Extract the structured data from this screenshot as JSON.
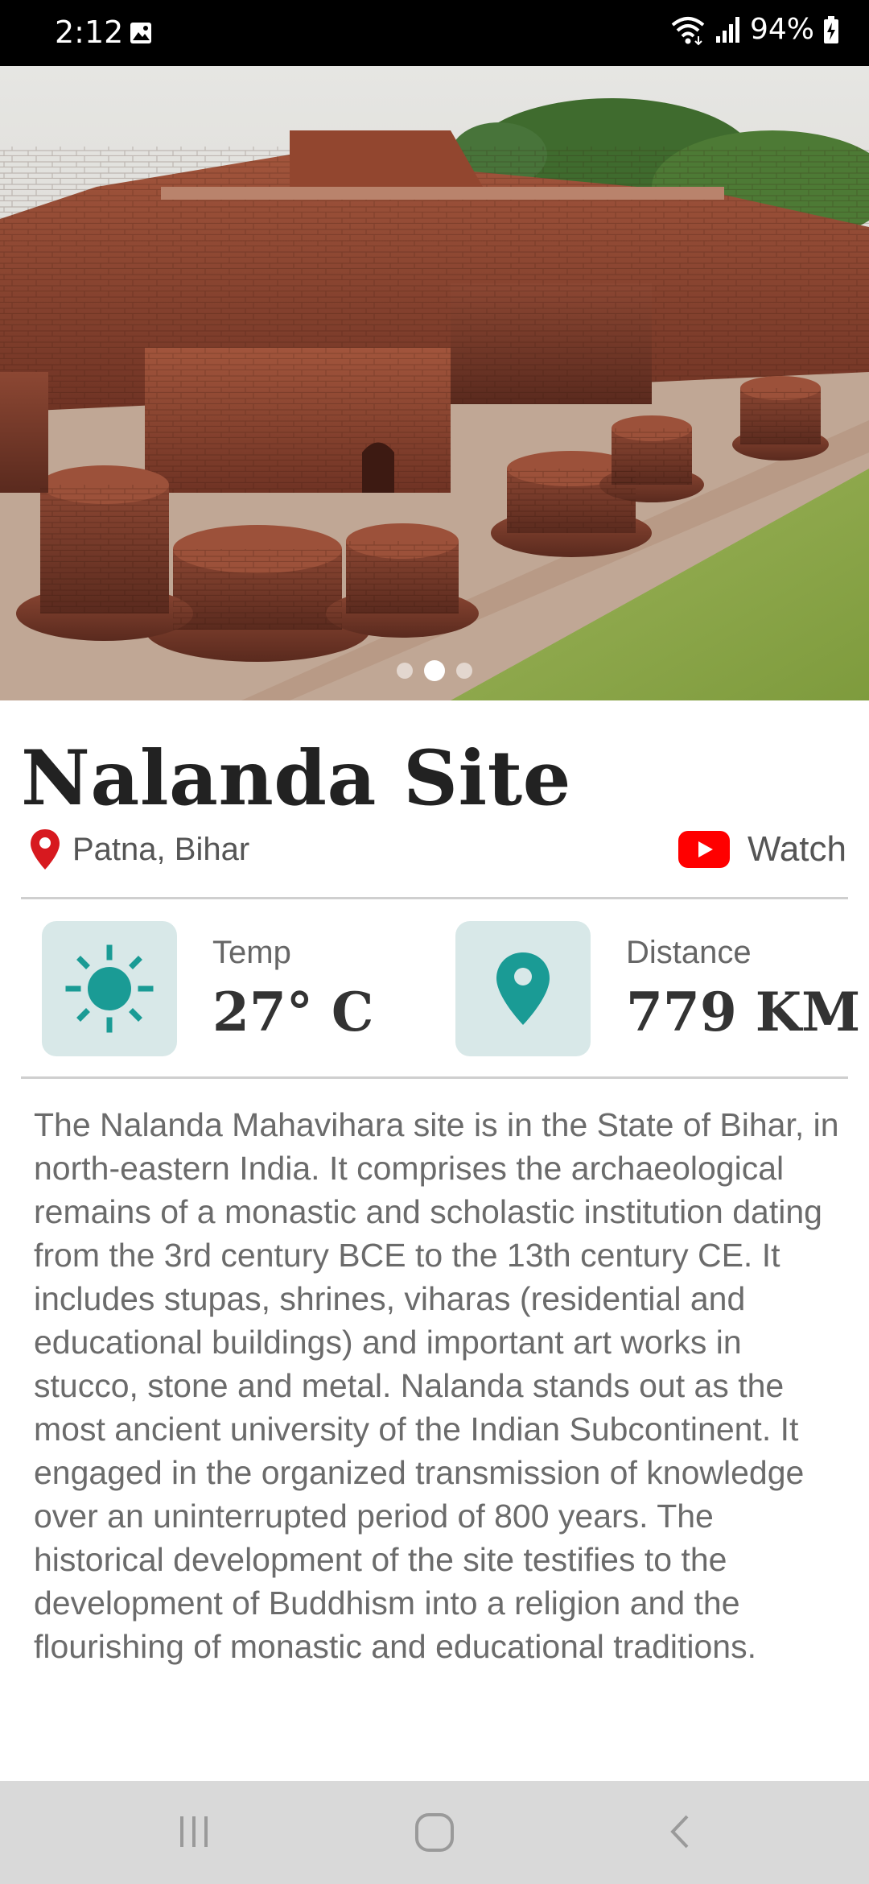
{
  "status_bar": {
    "time": "2:12",
    "battery": "94%",
    "icons": [
      "gallery-icon",
      "wifi-icon",
      "signal-icon",
      "battery-icon"
    ]
  },
  "hero": {
    "image": "nalanda-ruins-photo",
    "carousel": {
      "count": 3,
      "active_index": 1
    }
  },
  "site": {
    "name": "Nalanda Site",
    "location": "Patna, Bihar",
    "watch_label": "Watch"
  },
  "info": {
    "temp_label": "Temp",
    "temp_value": "27° C",
    "distance_label": "Distance",
    "distance_value": "779 KM"
  },
  "description": "The Nalanda Mahavihara site is in the State of Bihar, in north-eastern India. It comprises the archaeological remains of a monastic and scholastic institution dating from the 3rd century BCE to the 13th century CE. It includes stupas, shrines, viharas (residential and educational buildings) and important art works in stucco, stone and metal. Nalanda stands out as the most ancient university of the Indian Subcontinent. It engaged in the organized transmission of knowledge over an uninterrupted period of 800 years. The historical development of the site testifies to the development of Buddhism into a religion and the flourishing of monastic and educational traditions.",
  "colors": {
    "accent_teal": "#1a9b95",
    "tile_bg": "#d8e8e8",
    "pin_red": "#d7191f",
    "youtube_red": "#ff0000"
  },
  "nav": [
    "recent-apps-button",
    "home-button",
    "back-button"
  ]
}
